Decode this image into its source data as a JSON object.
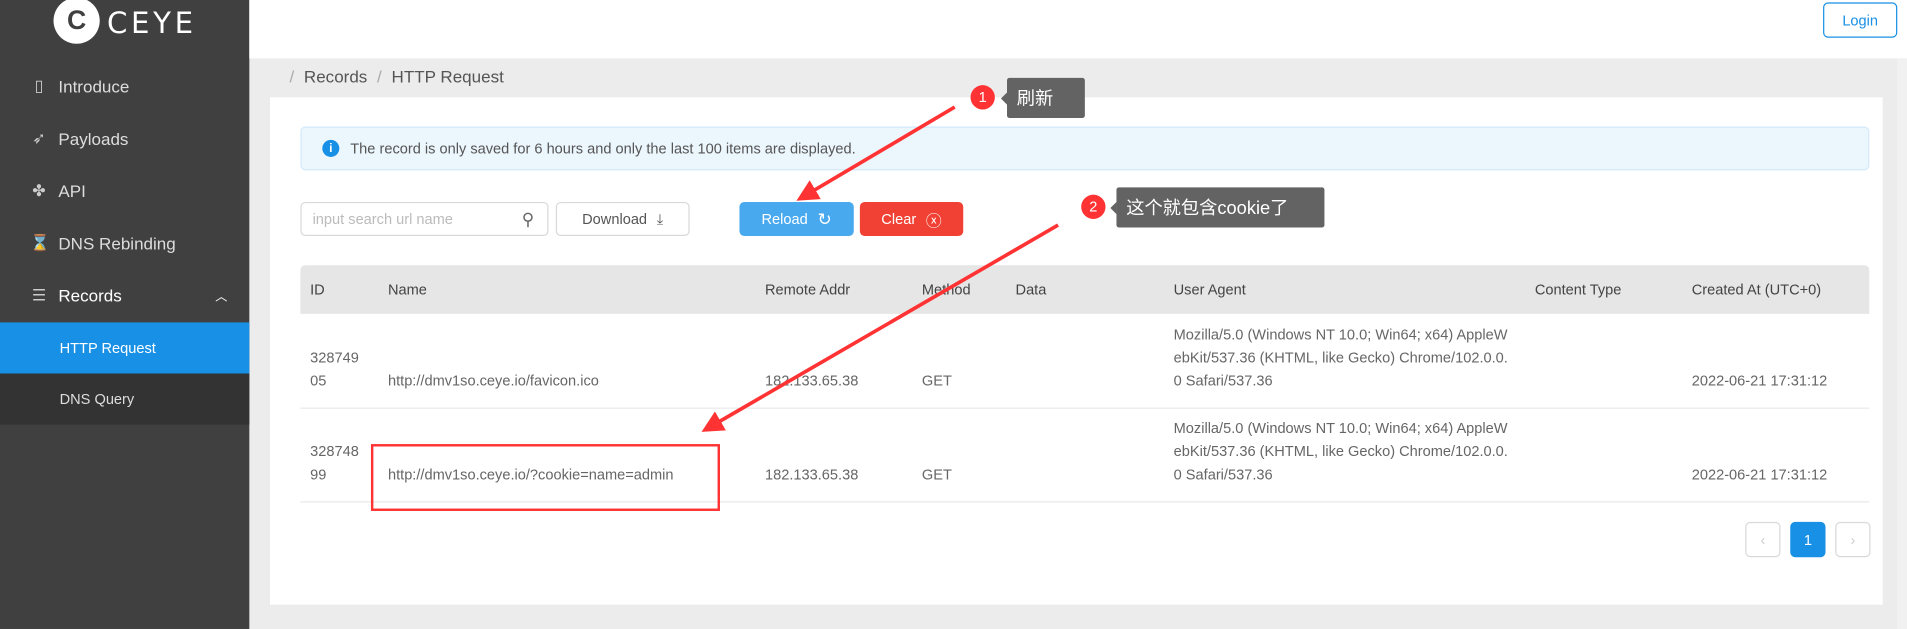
{
  "brand": {
    "name": "CEYE"
  },
  "sidebar": {
    "items": [
      {
        "label": "Introduce",
        "icon": "book-icon"
      },
      {
        "label": "Payloads",
        "icon": "rocket-icon"
      },
      {
        "label": "API",
        "icon": "api-icon"
      },
      {
        "label": "DNS Rebinding",
        "icon": "hourglass-icon"
      },
      {
        "label": "Records",
        "icon": "list-icon"
      }
    ],
    "sub_items": [
      {
        "label": "HTTP Request",
        "active": true
      },
      {
        "label": "DNS Query",
        "active": false
      }
    ]
  },
  "header": {
    "login_label": "Login"
  },
  "breadcrumb": {
    "sep": "/",
    "items": [
      "Records",
      "HTTP Request"
    ]
  },
  "alert": {
    "text": "The record is only saved for 6 hours and only the last 100 items are displayed."
  },
  "toolbar": {
    "search_placeholder": "input search url name",
    "download_label": "Download",
    "reload_label": "Reload",
    "clear_label": "Clear"
  },
  "table": {
    "columns": [
      "ID",
      "Name",
      "Remote Addr",
      "Method",
      "Data",
      "User Agent",
      "Content Type",
      "Created At (UTC+0)"
    ],
    "rows": [
      {
        "id": "32874905",
        "name": "http://dmv1so.ceye.io/favicon.ico",
        "remote": "182.133.65.38",
        "method": "GET",
        "data": "",
        "ua": "Mozilla/5.0 (Windows NT 10.0; Win64; x64) AppleWebKit/537.36 (KHTML, like Gecko) Chrome/102.0.0.0 Safari/537.36",
        "ctype": "",
        "created": "2022-06-21 17:31:12"
      },
      {
        "id": "32874899",
        "name": "http://dmv1so.ceye.io/?cookie=name=admin",
        "remote": "182.133.65.38",
        "method": "GET",
        "data": "",
        "ua": "Mozilla/5.0 (Windows NT 10.0; Win64; x64) AppleWebKit/537.36 (KHTML, like Gecko) Chrome/102.0.0.0 Safari/537.36",
        "ctype": "",
        "created": "2022-06-21 17:31:12"
      }
    ]
  },
  "pagination": {
    "prev": "‹",
    "current": "1",
    "next": "›"
  },
  "annotations": [
    {
      "num": "1",
      "text": "刷新"
    },
    {
      "num": "2",
      "text": "这个就包含cookie了"
    }
  ],
  "colors": {
    "sidebar": "#404040",
    "active": "#1890e5",
    "reload": "#49a9ee",
    "clear": "#f04134",
    "annotation": "#ff3333"
  }
}
